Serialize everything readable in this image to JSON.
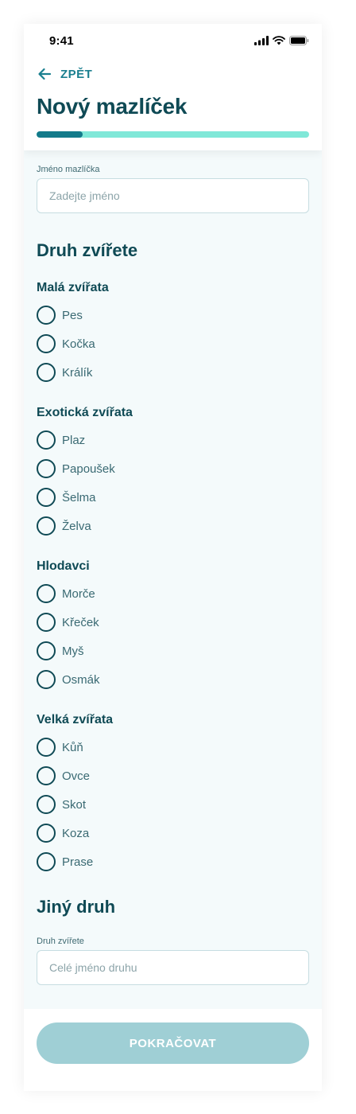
{
  "status_bar": {
    "time": "9:41"
  },
  "header": {
    "back_label": "ZPĚT",
    "title": "Nový mazlíček",
    "progress": 0.17
  },
  "pet_name": {
    "label": "Jméno mazlíčka",
    "placeholder": "Zadejte jméno",
    "value": ""
  },
  "species": {
    "title": "Druh zvířete",
    "groups": [
      {
        "title": "Malá zvířata",
        "options": [
          "Pes",
          "Kočka",
          "Králík"
        ]
      },
      {
        "title": "Exotická zvířata",
        "options": [
          "Plaz",
          "Papoušek",
          "Šelma",
          "Želva"
        ]
      },
      {
        "title": "Hlodavci",
        "options": [
          "Morče",
          "Křeček",
          "Myš",
          "Osmák"
        ]
      },
      {
        "title": "Velká zvířata",
        "options": [
          "Kůň",
          "Ovce",
          "Skot",
          "Koza",
          "Prase"
        ]
      }
    ]
  },
  "other_species": {
    "title": "Jiný druh",
    "label": "Druh zvířete",
    "placeholder": "Celé jméno druhu",
    "value": ""
  },
  "footer": {
    "continue_label": "POKRAČOVAT"
  },
  "colors": {
    "primary": "#0f4a55",
    "accent": "#1a7f8f",
    "progress_track": "#80e8d8",
    "button_disabled": "#9fcfd5"
  }
}
